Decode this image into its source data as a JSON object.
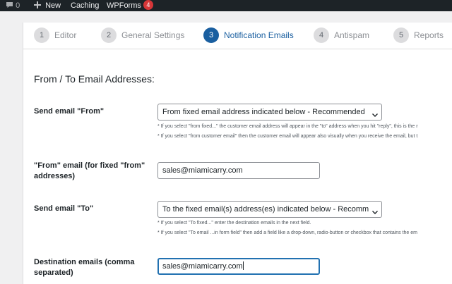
{
  "adminbar": {
    "comments_count": "0",
    "new_label": "New",
    "caching_label": "Caching",
    "wpforms_label": "WPForms",
    "wpforms_badge": "4"
  },
  "steps": [
    {
      "num": "1",
      "label": "Editor"
    },
    {
      "num": "2",
      "label": "General Settings"
    },
    {
      "num": "3",
      "label": "Notification Emails"
    },
    {
      "num": "4",
      "label": "Antispam"
    },
    {
      "num": "5",
      "label": "Reports"
    }
  ],
  "active_step": "3",
  "section": {
    "heading": "From / To Email Addresses:"
  },
  "fields": {
    "send_from": {
      "label": "Send email \"From\"",
      "selected": "From fixed email address indicated below - Recommended",
      "note1": "* If you select \"from fixed...\" the customer email address will appear in the \"to\" address when you hit \"reply\", this is the r",
      "note2": "* If you select \"from customer email\" then the customer email will appear also visually when you receive the email, but t"
    },
    "from_email": {
      "label": "\"From\" email (for fixed \"from\" addresses)",
      "value": "sales@miamicarry.com"
    },
    "send_to": {
      "label": "Send email \"To\"",
      "selected": "To the fixed email(s) address(es) indicated below - Recomm",
      "note1": "* If you select \"To fixed...\" enter the destination emails in the next field.",
      "note2": "* If you select \"To email ...in form field\" then add a field like a drop-down, radio-button or checkbox that contains the em"
    },
    "destination": {
      "label": "Destination emails (comma separated)",
      "value": "sales@miamicarry.com"
    }
  },
  "colors": {
    "accent": "#1a5fa0",
    "adminbar_bg": "#1d2327",
    "badge": "#d63638"
  }
}
